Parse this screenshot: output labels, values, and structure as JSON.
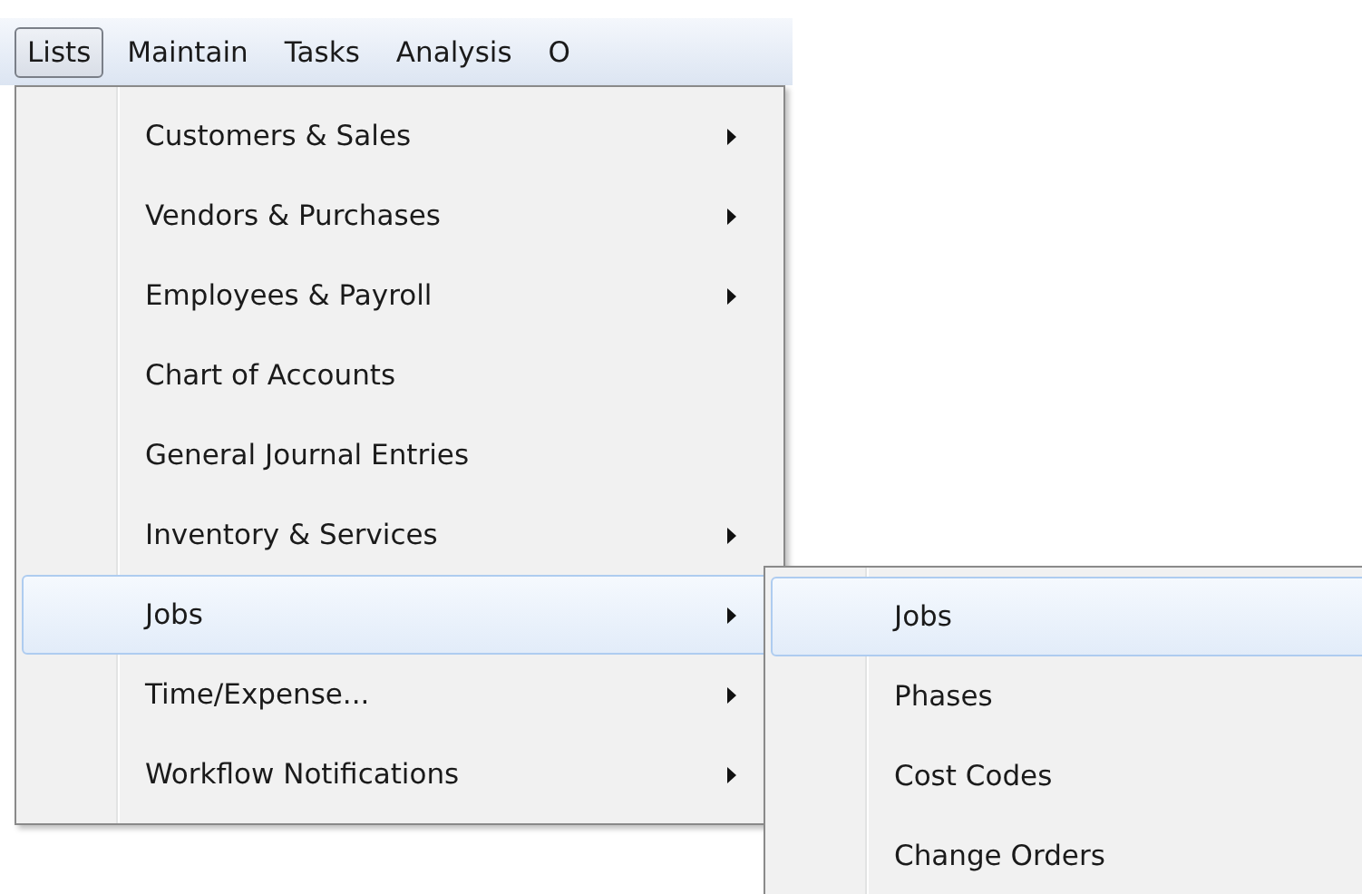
{
  "menubar": [
    {
      "label": "Lists",
      "selected": true
    },
    {
      "label": "Maintain",
      "selected": false
    },
    {
      "label": "Tasks",
      "selected": false
    },
    {
      "label": "Analysis",
      "selected": false
    },
    {
      "label": "O",
      "selected": false
    }
  ],
  "menu": {
    "items": [
      {
        "label": "Customers & Sales",
        "submenu": true,
        "selected": false
      },
      {
        "label": "Vendors & Purchases",
        "submenu": true,
        "selected": false
      },
      {
        "label": "Employees & Payroll",
        "submenu": true,
        "selected": false
      },
      {
        "label": "Chart of Accounts",
        "submenu": false,
        "selected": false
      },
      {
        "label": "General Journal Entries",
        "submenu": false,
        "selected": false
      },
      {
        "label": "Inventory & Services",
        "submenu": true,
        "selected": false
      },
      {
        "label": "Jobs",
        "submenu": true,
        "selected": true
      },
      {
        "label": "Time/Expense...",
        "submenu": true,
        "selected": false
      },
      {
        "label": "Workflow Notifications",
        "submenu": true,
        "selected": false
      }
    ]
  },
  "submenu": {
    "items": [
      {
        "label": "Jobs",
        "selected": true
      },
      {
        "label": "Phases",
        "selected": false
      },
      {
        "label": "Cost Codes",
        "selected": false
      },
      {
        "label": "Change Orders",
        "selected": false
      }
    ]
  }
}
